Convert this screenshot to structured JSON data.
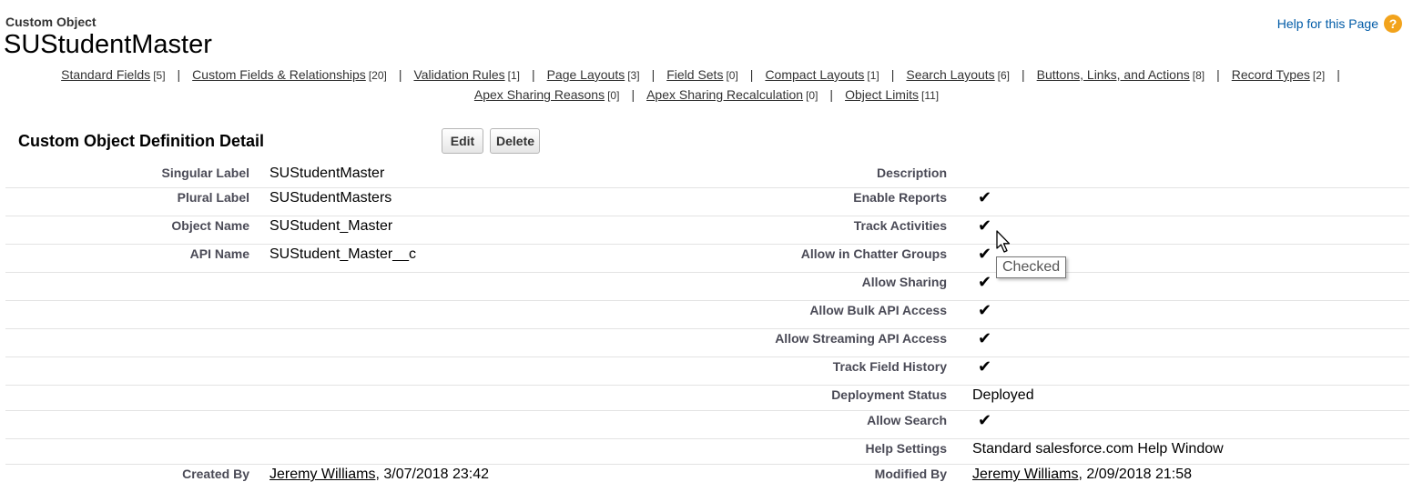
{
  "header": {
    "object_type": "Custom Object",
    "object_name": "SUStudentMaster",
    "help_link": "Help for this Page",
    "help_icon": "?"
  },
  "nav": {
    "line1": [
      {
        "label": "Standard Fields",
        "count": "[5]"
      },
      {
        "label": "Custom Fields & Relationships",
        "count": "[20]"
      },
      {
        "label": "Validation Rules",
        "count": "[1]"
      },
      {
        "label": "Page Layouts",
        "count": "[3]"
      },
      {
        "label": "Field Sets",
        "count": "[0]"
      },
      {
        "label": "Compact Layouts",
        "count": "[1]"
      },
      {
        "label": "Search Layouts",
        "count": "[6]"
      },
      {
        "label": "Buttons, Links, and Actions",
        "count": "[8]"
      },
      {
        "label": "Record Types",
        "count": "[2]"
      }
    ],
    "line2": [
      {
        "label": "Apex Sharing Reasons",
        "count": "[0]"
      },
      {
        "label": "Apex Sharing Recalculation",
        "count": "[0]"
      },
      {
        "label": "Object Limits",
        "count": "[11]"
      }
    ],
    "separator": "|"
  },
  "detail": {
    "title": "Custom Object Definition Detail",
    "edit_label": "Edit",
    "delete_label": "Delete",
    "checkmark": "✔",
    "left_fields": [
      {
        "label": "Singular Label",
        "value": "SUStudentMaster"
      },
      {
        "label": "Plural Label",
        "value": "SUStudentMasters"
      },
      {
        "label": "Object Name",
        "value": "SUStudent_Master"
      },
      {
        "label": "API Name",
        "value": "SUStudent_Master__c"
      }
    ],
    "right_fields": [
      {
        "label": "Description",
        "value": ""
      },
      {
        "label": "Enable Reports",
        "checked": true
      },
      {
        "label": "Track Activities",
        "checked": true
      },
      {
        "label": "Allow in Chatter Groups",
        "checked": true
      },
      {
        "label": "Allow Sharing",
        "checked": true
      },
      {
        "label": "Allow Bulk API Access",
        "checked": true
      },
      {
        "label": "Allow Streaming API Access",
        "checked": true
      },
      {
        "label": "Track Field History",
        "checked": true
      },
      {
        "label": "Deployment Status",
        "value": "Deployed"
      },
      {
        "label": "Allow Search",
        "checked": true
      },
      {
        "label": "Help Settings",
        "value": "Standard salesforce.com Help Window"
      }
    ],
    "created_by": {
      "label": "Created By",
      "user": "Jeremy Williams",
      "date": ", 3/07/2018 23:42"
    },
    "modified_by": {
      "label": "Modified By",
      "user": "Jeremy Williams",
      "date": ", 2/09/2018 21:58"
    }
  },
  "tooltip": {
    "text": "Checked"
  }
}
